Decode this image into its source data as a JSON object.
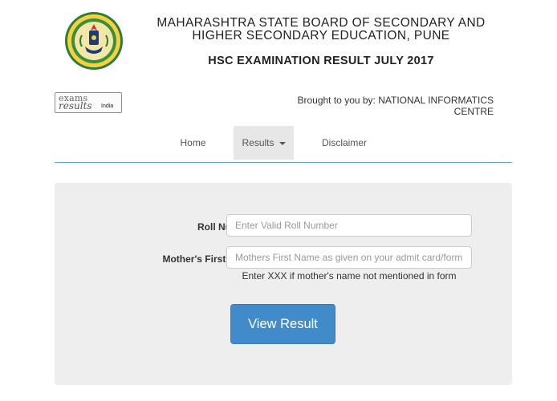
{
  "header": {
    "board_title": "MAHARASHTRA STATE BOARD OF SECONDARY AND HIGHER SECONDARY EDUCATION, PUNE",
    "exam_title": "HSC EXAMINATION RESULT JULY 2017",
    "seal_text_top": "उच्च माध्यमिक शिक्षण",
    "seal_text_bottom": "पुणे"
  },
  "partner_logo": {
    "line1": "exams",
    "line2": "results",
    "line3": "India"
  },
  "credit": "Brought to you by: NATIONAL INFORMATICS CENTRE",
  "nav": {
    "home": "Home",
    "results": "Results",
    "disclaimer": "Disclaimer"
  },
  "form": {
    "roll_label": "Roll Number:*",
    "roll_placeholder": "Enter Valid Roll Number",
    "roll_value": "",
    "mother_label": "Mother's First Name:*",
    "mother_placeholder": "Mothers First Name as given on your admit card/form",
    "mother_value": "",
    "hint": "Enter XXX if mother's name not mentioned in form",
    "submit_label": "View Result"
  },
  "colors": {
    "accent": "#428bca",
    "nav_rule": "#5aa6c9",
    "panel_bg": "#eeeeee"
  }
}
